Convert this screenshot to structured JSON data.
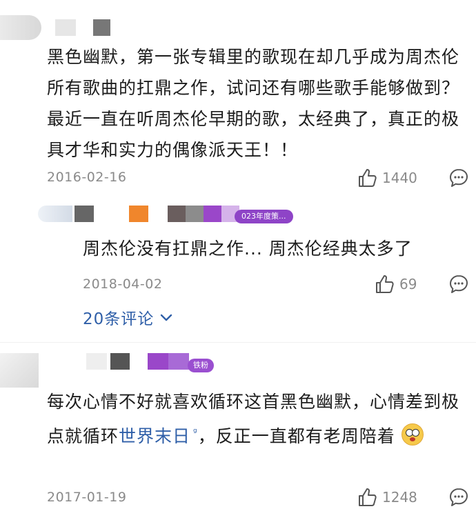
{
  "comments": [
    {
      "text": "黑色幽默，第一张专辑里的歌现在却几乎成为周杰伦所有歌曲的扛鼎之作，试问还有哪些歌手能够做到？最近一直在听周杰伦早期的歌，太经典了，真正的极具才华和实力的偶像派天王！！",
      "date": "2016-02-16",
      "likes": "1440",
      "reply": {
        "badge": "023年度策...",
        "text": "周杰伦没有扛鼎之作... 周杰伦经典太多了",
        "date": "2018-04-02",
        "likes": "69"
      },
      "more_replies": "20条评论"
    },
    {
      "badge": "铁粉",
      "text_before_link": "每次心情不好就喜欢循环这首黑色幽默，心情差到极点就循环",
      "link_text": "世界末日",
      "text_after_link": "，反正一直都有老周陪着",
      "date": "2017-01-19",
      "likes": "1248"
    }
  ],
  "icons": {
    "like": "thumbs-up-icon",
    "reply": "comment-bubble-icon",
    "chevron": "chevron-down-icon",
    "emoji": "flushed-face-emoji"
  },
  "colors": {
    "link": "#2f5fa8",
    "badge": "#8e44c7",
    "meta": "#8a8a8a"
  }
}
